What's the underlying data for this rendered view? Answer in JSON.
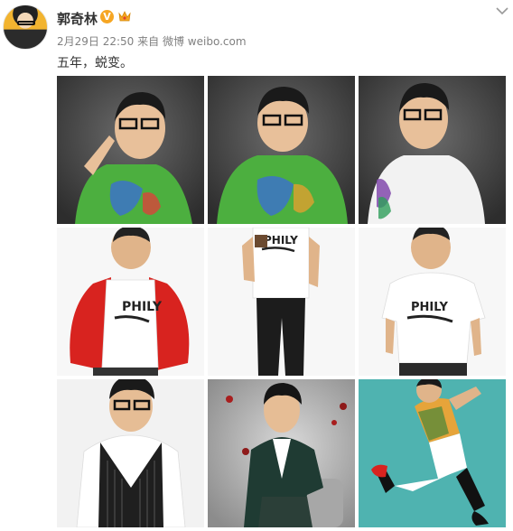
{
  "post": {
    "username": "郭奇林",
    "verified_badge": "V",
    "date": "2月29日 22:50",
    "source_prefix": "来自",
    "source": "微博 weibo.com",
    "text": "五年，蜕变。"
  },
  "icons": {
    "avatar": "avatar",
    "verified": "verified-badge-icon",
    "medal": "member-medal-icon",
    "menu": "chevron-down-icon"
  },
  "colors": {
    "username": "#333333",
    "meta": "#808080",
    "verified": "#f6a623"
  },
  "photos": [
    {
      "row": 1,
      "col": 1,
      "desc": "peace-sign pose, green t-shirt, dark background"
    },
    {
      "row": 1,
      "col": 2,
      "desc": "green t-shirt, dark background"
    },
    {
      "row": 1,
      "col": 3,
      "desc": "white t-shirt, dark background"
    },
    {
      "row": 2,
      "col": 1,
      "desc": "red jacket over white PHILY t-shirt"
    },
    {
      "row": 2,
      "col": 2,
      "desc": "PHILY t-shirt, black pants"
    },
    {
      "row": 2,
      "col": 3,
      "desc": "white PHILY t-shirt"
    },
    {
      "row": 3,
      "col": 1,
      "desc": "striped vest with glasses"
    },
    {
      "row": 3,
      "col": 2,
      "desc": "dark suit seated, grey background"
    },
    {
      "row": 3,
      "col": 3,
      "desc": "jumping pose, teal background"
    }
  ],
  "photo_texts": {
    "shirt_logo": "PHILY"
  }
}
